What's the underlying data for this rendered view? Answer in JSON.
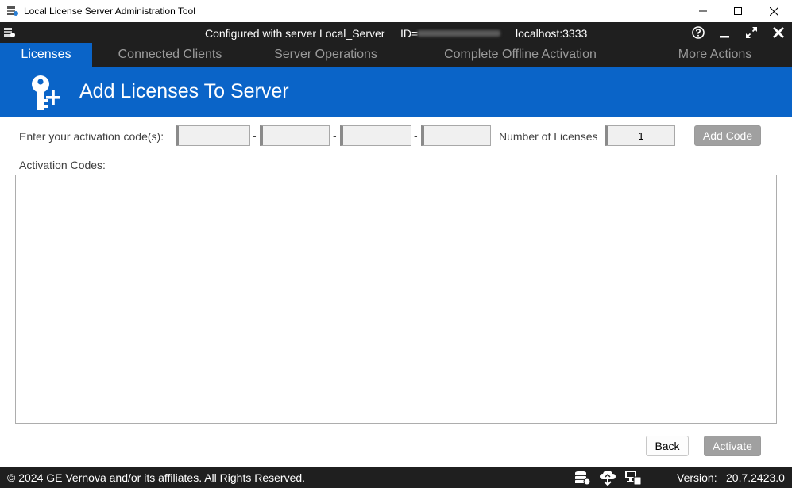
{
  "window": {
    "title": "Local License Server Administration Tool"
  },
  "server": {
    "configured_text": "Configured with server Local_Server",
    "id_label": "ID=",
    "host": "localhost:3333"
  },
  "tabs": [
    {
      "label": "Licenses",
      "active": true
    },
    {
      "label": "Connected Clients",
      "active": false
    },
    {
      "label": "Server Operations",
      "active": false
    },
    {
      "label": "Complete Offline Activation",
      "active": false
    },
    {
      "label": "More Actions",
      "active": false
    }
  ],
  "header": {
    "title": "Add Licenses To Server"
  },
  "form": {
    "activation_label": "Enter your activation code(s):",
    "code_parts": [
      "",
      "",
      "",
      ""
    ],
    "separator": "-",
    "num_licenses_label": "Number of Licenses",
    "num_licenses_value": "1",
    "add_code_label": "Add Code",
    "codes_list_label": "Activation Codes:"
  },
  "actions": {
    "back_label": "Back",
    "activate_label": "Activate"
  },
  "footer": {
    "copyright": "© 2024 GE Vernova and/or its affiliates.  All Rights Reserved.",
    "version_label": "Version:",
    "version_value": "20.7.2423.0"
  },
  "colors": {
    "accent": "#0a64c8",
    "dark_bar": "#1f1f1f",
    "disabled_button": "#a0a0a0"
  },
  "icons": {
    "app": "license-server-icon",
    "help": "help-icon",
    "minimize": "minimize-icon",
    "maximize": "expand-icon",
    "close": "close-icon",
    "header": "key-add-icon",
    "footer": [
      "database-icon",
      "cloud-sync-icon",
      "computer-network-icon"
    ]
  }
}
